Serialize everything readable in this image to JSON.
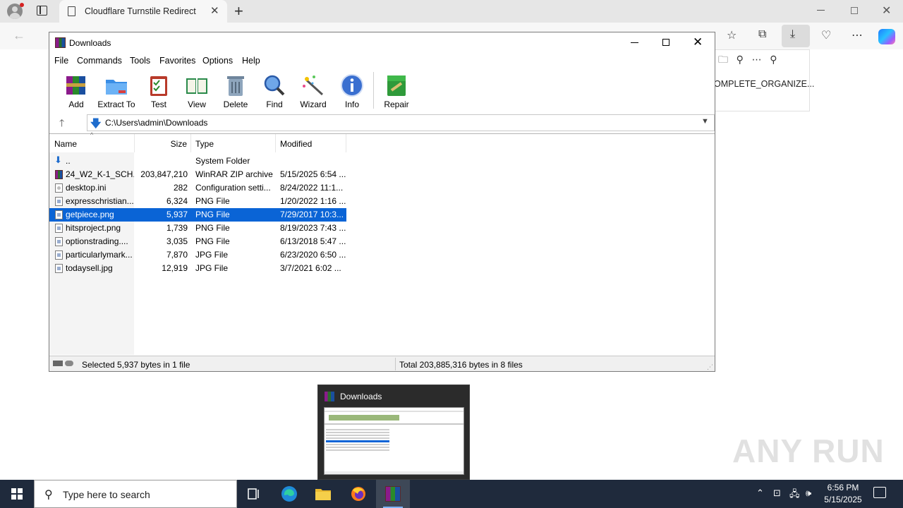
{
  "browser": {
    "tab_title": "Cloudflare Turnstile Redirect",
    "downloads_panel_file": "OMPLETE_ORGANIZE..."
  },
  "winrar": {
    "window_title": "Downloads",
    "menu": [
      "File",
      "Commands",
      "Tools",
      "Favorites",
      "Options",
      "Help"
    ],
    "toolbar": [
      {
        "label": "Add",
        "icon": "add-archive-icon"
      },
      {
        "label": "Extract To",
        "icon": "extract-folder-icon"
      },
      {
        "label": "Test",
        "icon": "test-clipboard-icon"
      },
      {
        "label": "View",
        "icon": "view-book-icon"
      },
      {
        "label": "Delete",
        "icon": "trash-icon"
      },
      {
        "label": "Find",
        "icon": "magnifier-icon"
      },
      {
        "label": "Wizard",
        "icon": "wizard-wand-icon"
      },
      {
        "label": "Info",
        "icon": "info-icon"
      },
      {
        "label": "Repair",
        "icon": "repair-kit-icon"
      }
    ],
    "path": "C:\\Users\\admin\\Downloads",
    "columns": {
      "name": "Name",
      "size": "Size",
      "type": "Type",
      "modified": "Modified"
    },
    "files": [
      {
        "name": "..",
        "size": "",
        "type": "System Folder",
        "modified": "",
        "icon": "up-folder"
      },
      {
        "name": "24_W2_K-1_SCH...",
        "size": "203,847,210",
        "type": "WinRAR ZIP archive",
        "modified": "5/15/2025 6:54 ...",
        "icon": "rar"
      },
      {
        "name": "desktop.ini",
        "size": "282",
        "type": "Configuration setti...",
        "modified": "8/24/2022 11:1...",
        "icon": "ini"
      },
      {
        "name": "expresschristian....",
        "size": "6,324",
        "type": "PNG File",
        "modified": "1/20/2022 1:16 ...",
        "icon": "image"
      },
      {
        "name": "getpiece.png",
        "size": "5,937",
        "type": "PNG File",
        "modified": "7/29/2017 10:3...",
        "icon": "image",
        "selected": true
      },
      {
        "name": "hitsproject.png",
        "size": "1,739",
        "type": "PNG File",
        "modified": "8/19/2023 7:43 ...",
        "icon": "image"
      },
      {
        "name": "optionstrading....",
        "size": "3,035",
        "type": "PNG File",
        "modified": "6/13/2018 5:47 ...",
        "icon": "image"
      },
      {
        "name": "particularlymark...",
        "size": "7,870",
        "type": "JPG File",
        "modified": "6/23/2020 6:50 ...",
        "icon": "image"
      },
      {
        "name": "todaysell.jpg",
        "size": "12,919",
        "type": "JPG File",
        "modified": "3/7/2021 6:02 ...",
        "icon": "image"
      }
    ],
    "status_left": "Selected 5,937 bytes in 1 file",
    "status_right": "Total 203,885,316 bytes in 8 files"
  },
  "thumbnail": {
    "title": "Downloads"
  },
  "watermark": "ANY RUN",
  "taskbar": {
    "search_placeholder": "Type here to search",
    "time": "6:56 PM",
    "date": "5/15/2025"
  },
  "colors": {
    "selection": "#0a64d6",
    "taskbar": "#1f2a3c"
  }
}
